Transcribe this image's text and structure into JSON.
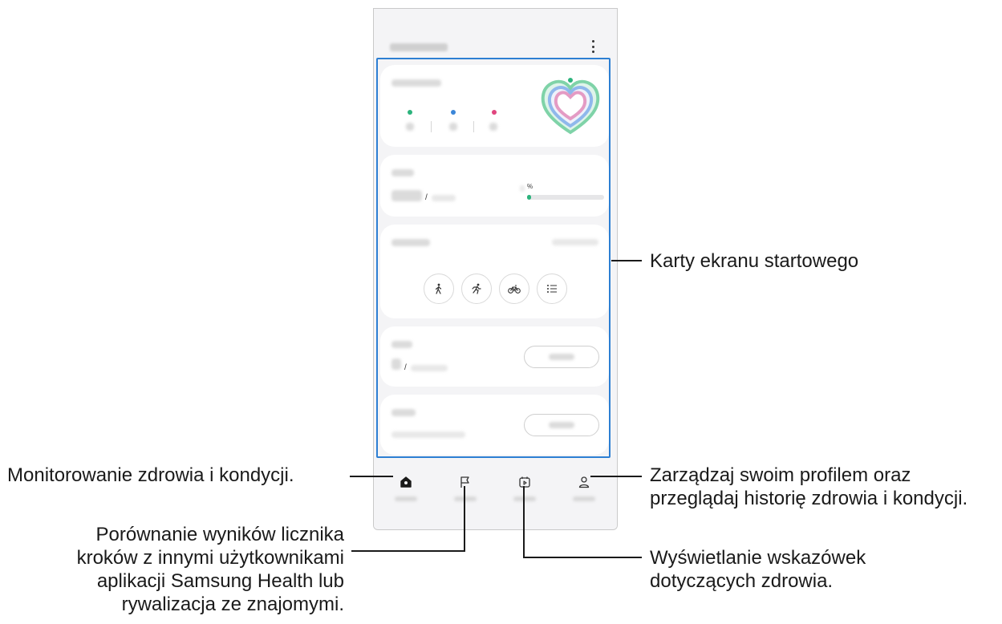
{
  "phone": {
    "activity_counts": [
      "–",
      "–",
      "–"
    ],
    "percent_symbol": "%",
    "slash": "/"
  },
  "annotations": {
    "home_cards": "Karty ekranu startowego",
    "home_tab": "Monitorowanie zdrowia i kondycji.",
    "together_tab": [
      "Porównanie wyników licznika",
      "kroków z innymi użytkownikami",
      "aplikacji Samsung Health lub",
      "rywalizacja ze znajomymi."
    ],
    "fitness_tab": [
      "Wyświetlanie wskazówek",
      "dotyczących zdrowia."
    ],
    "profile_tab": [
      "Zarządzaj swoim profilem oraz",
      "przeglądaj historię zdrowia i kondycji."
    ]
  },
  "icons": {
    "more": "more-vertical-icon",
    "nav": [
      "home-icon",
      "flag-icon",
      "play-calendar-icon",
      "person-icon"
    ],
    "workouts": [
      "walk-icon",
      "run-icon",
      "bike-icon",
      "list-icon"
    ]
  },
  "colors": {
    "highlight": "#2d7fd3",
    "steps": "#2cb37c",
    "active_time": "#3b86d8",
    "calories": "#e0467e",
    "heart_ring_outer": "#7fd3a8",
    "heart_ring_mid": "#8fb8ec",
    "heart_ring_inner": "#e49bc4"
  }
}
